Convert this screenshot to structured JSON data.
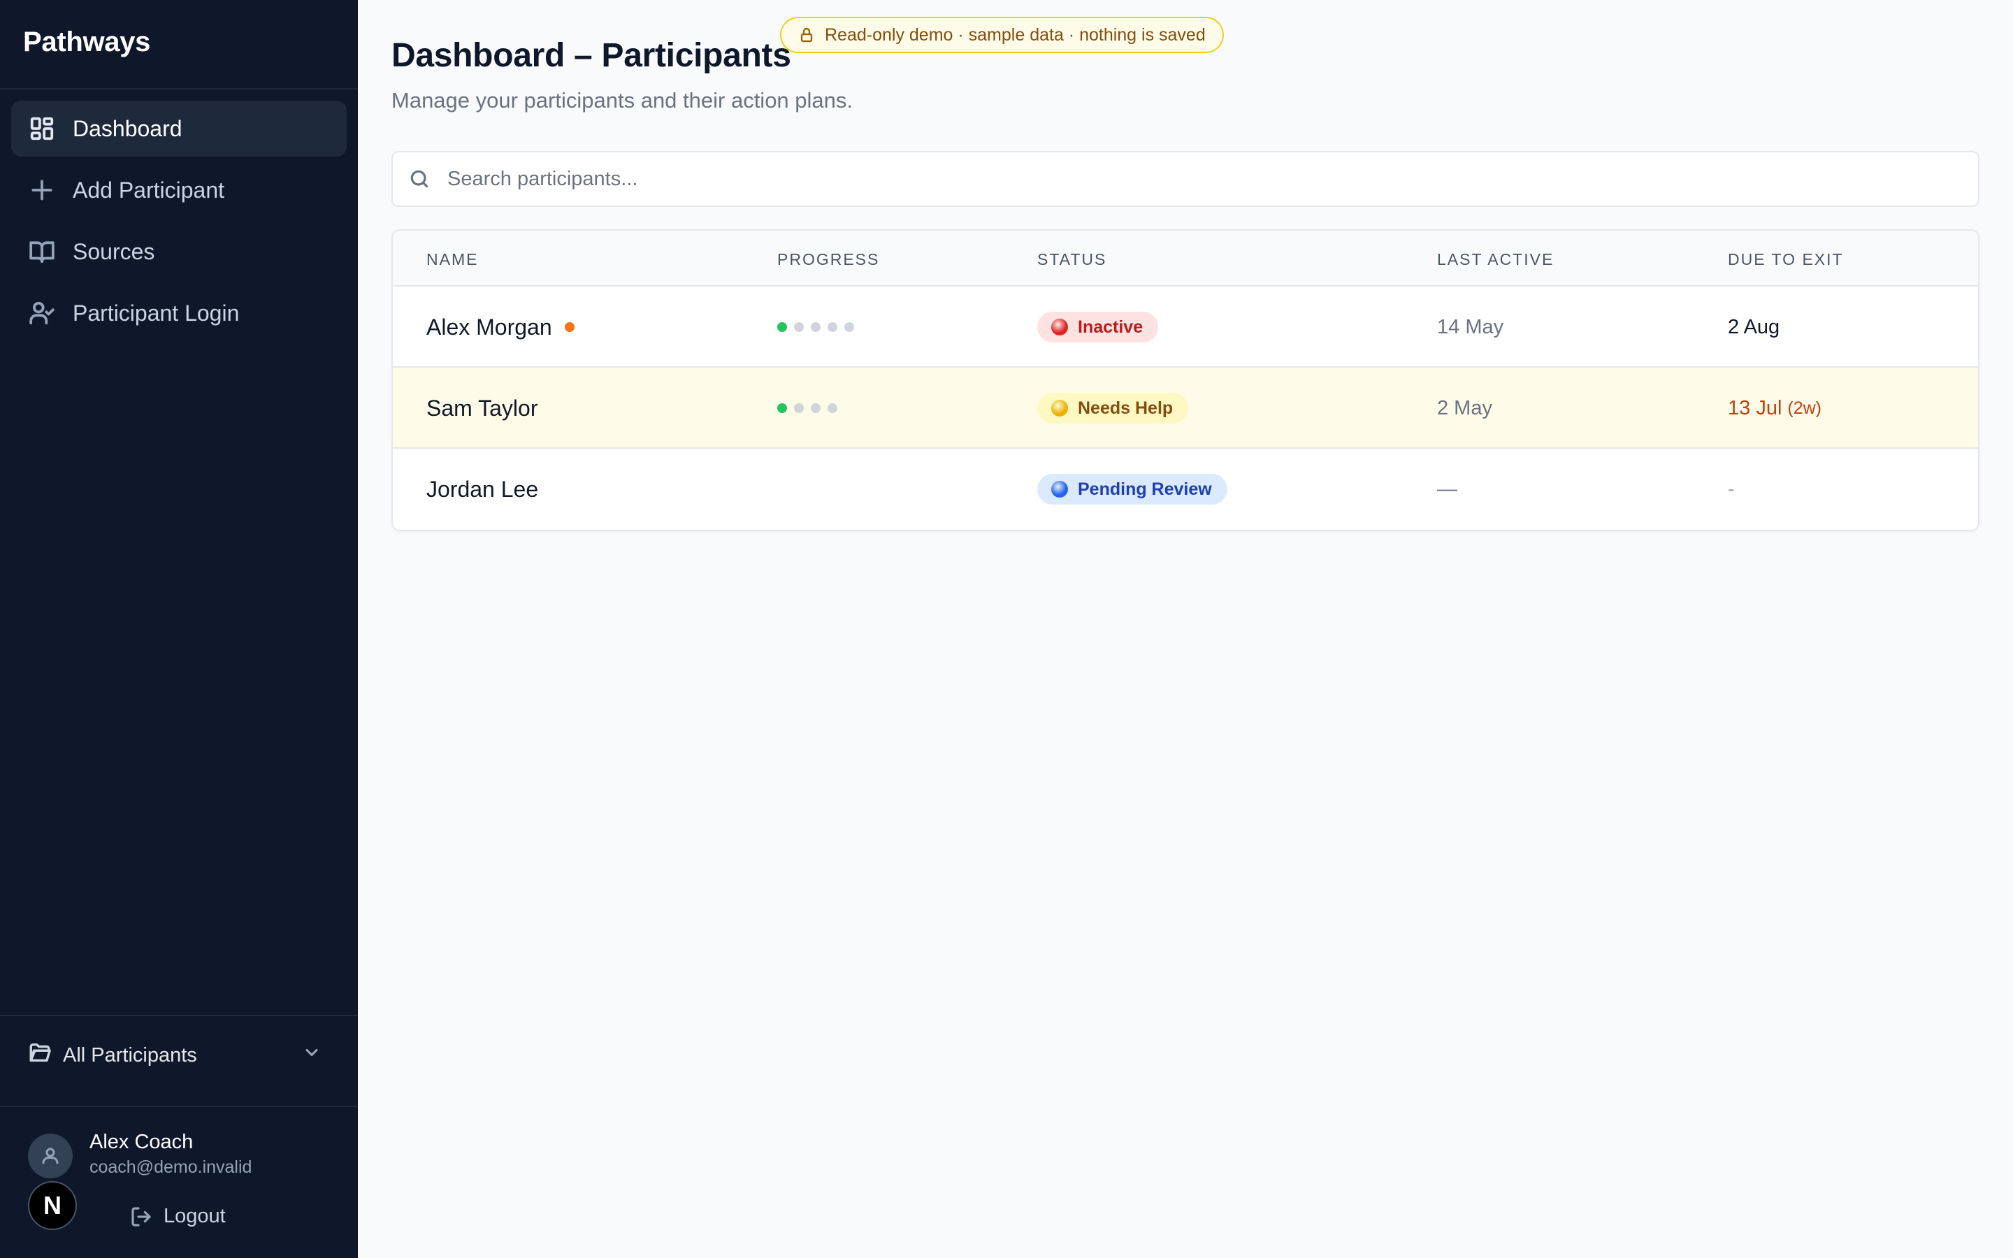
{
  "app": {
    "name": "Pathways"
  },
  "sidebar": {
    "items": [
      {
        "label": "Dashboard",
        "icon": "dashboard-grid-icon",
        "active": true
      },
      {
        "label": "Add Participant",
        "icon": "plus-icon",
        "active": false
      },
      {
        "label": "Sources",
        "icon": "book-open-icon",
        "active": false
      },
      {
        "label": "Participant Login",
        "icon": "user-check-icon",
        "active": false
      }
    ],
    "group_select": {
      "label": "All Participants",
      "icon": "folder-icon"
    },
    "user": {
      "name": "Alex Coach",
      "email": "coach@demo.invalid"
    },
    "framework_badge": "N",
    "logout_label": "Logout"
  },
  "banner": {
    "text": "Read-only demo · sample data · nothing is saved",
    "icon": "lock-icon"
  },
  "page": {
    "title": "Dashboard – Participants",
    "subtitle": "Manage your participants and their action plans."
  },
  "search": {
    "placeholder": "Search participants...",
    "value": ""
  },
  "table": {
    "columns": [
      "NAME",
      "PROGRESS",
      "STATUS",
      "LAST ACTIVE",
      "DUE TO EXIT"
    ],
    "rows": [
      {
        "name": "Alex Morgan",
        "has_alert": true,
        "progress_total": 5,
        "progress_done": 1,
        "status": "Inactive",
        "status_bg": "#fee2e2",
        "status_fg": "#b91c1c",
        "status_dot": "#dc2626",
        "last_active": "14 May",
        "due": "2 Aug",
        "due_sub": "",
        "highlight": false
      },
      {
        "name": "Sam Taylor",
        "has_alert": false,
        "progress_total": 4,
        "progress_done": 1,
        "status": "Needs Help",
        "status_bg": "#fef9c3",
        "status_fg": "#854d0e",
        "status_dot": "#eab308",
        "last_active": "2 May",
        "due": "13 Jul",
        "due_sub": "(2w)",
        "highlight": true
      },
      {
        "name": "Jordan Lee",
        "has_alert": false,
        "progress_total": 0,
        "progress_done": 0,
        "status": "Pending Review",
        "status_bg": "#dbeafe",
        "status_fg": "#1e40af",
        "status_dot": "#2563eb",
        "last_active": "—",
        "due": "-",
        "due_sub": "",
        "highlight": false
      }
    ]
  },
  "colors": {
    "sidebar_bg": "#0f172a",
    "page_bg": "#f8fafc",
    "progress_done": "#22c55e",
    "alert": "#f97316"
  }
}
